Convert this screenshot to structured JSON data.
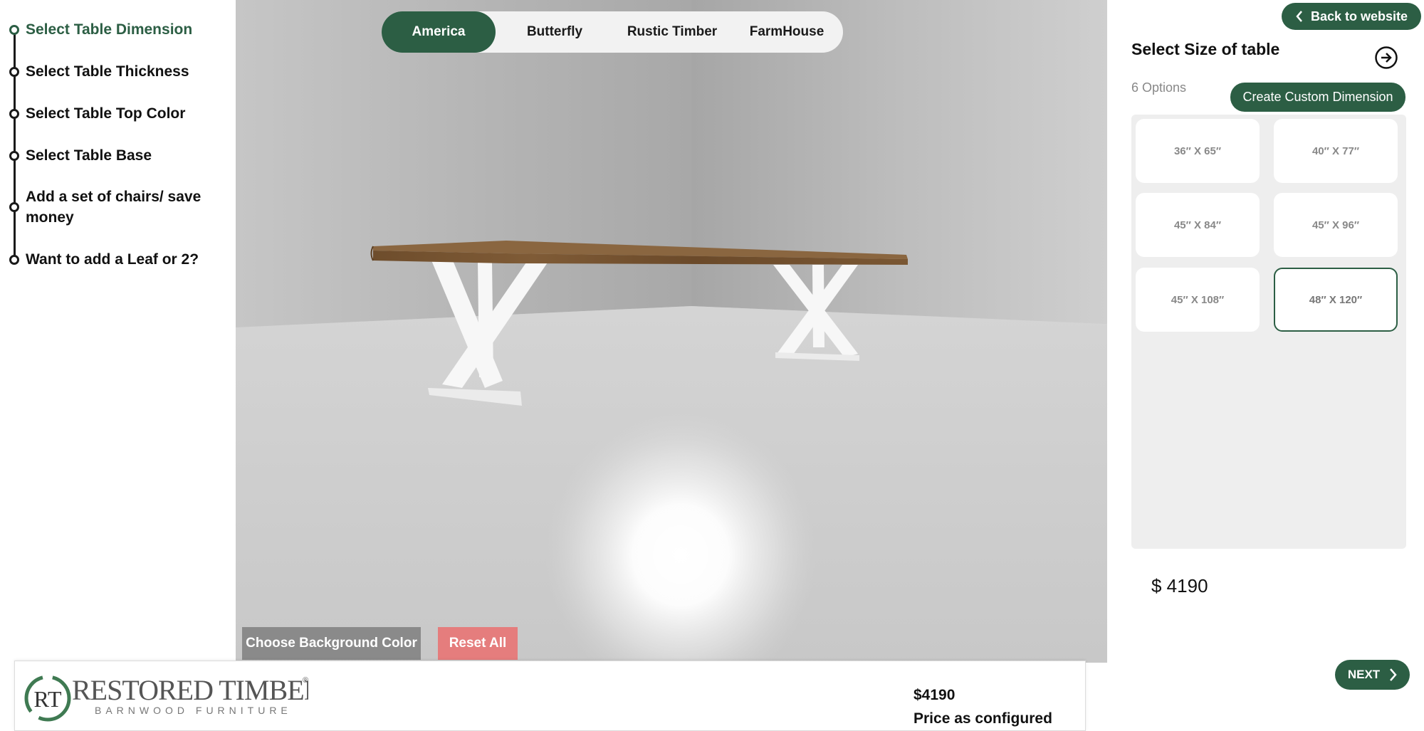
{
  "steps": [
    {
      "label": "Select Table Dimension",
      "active": true
    },
    {
      "label": "Select Table Thickness",
      "active": false
    },
    {
      "label": "Select Table Top Color",
      "active": false
    },
    {
      "label": "Select Table Base",
      "active": false
    },
    {
      "label": "Add a set of chairs/ save money",
      "active": false
    },
    {
      "label": "Want to add a Leaf or 2?",
      "active": false
    }
  ],
  "style_tabs": [
    {
      "label": "America",
      "active": true
    },
    {
      "label": "Butterfly",
      "active": false
    },
    {
      "label": "Rustic Timber",
      "active": false
    },
    {
      "label": "FarmHouse",
      "active": false
    }
  ],
  "viewer": {
    "background_button": "Choose Background Color",
    "reset_button": "Reset All"
  },
  "footer": {
    "logo_text": "RESTORED TIMBERS",
    "logo_subtext": "BARNWOOD FURNITURE",
    "logo_mark": "RT",
    "price": "$4190",
    "price_caption": "Price as configured"
  },
  "panel": {
    "back_button": "Back to website",
    "title": "Select Size of table",
    "options_count": "6 Options",
    "custom_button": "Create Custom Dimension",
    "sizes": [
      {
        "label": "36″ X 65″",
        "selected": false
      },
      {
        "label": "40″ X 77″",
        "selected": false
      },
      {
        "label": "45″ X 84″",
        "selected": false
      },
      {
        "label": "45″ X 96″",
        "selected": false
      },
      {
        "label": "45″ X 108″",
        "selected": false
      },
      {
        "label": "48″ X 120″",
        "selected": true
      }
    ],
    "price": "$ 4190",
    "next_button": "NEXT"
  },
  "colors": {
    "accent": "#2c5e44",
    "reset": "#e57d7d",
    "background_button": "#8a8a8a"
  },
  "icons": {
    "back": "chevron-left-icon",
    "panel_next": "arrow-right-circle-icon",
    "next": "chevron-right-icon"
  }
}
